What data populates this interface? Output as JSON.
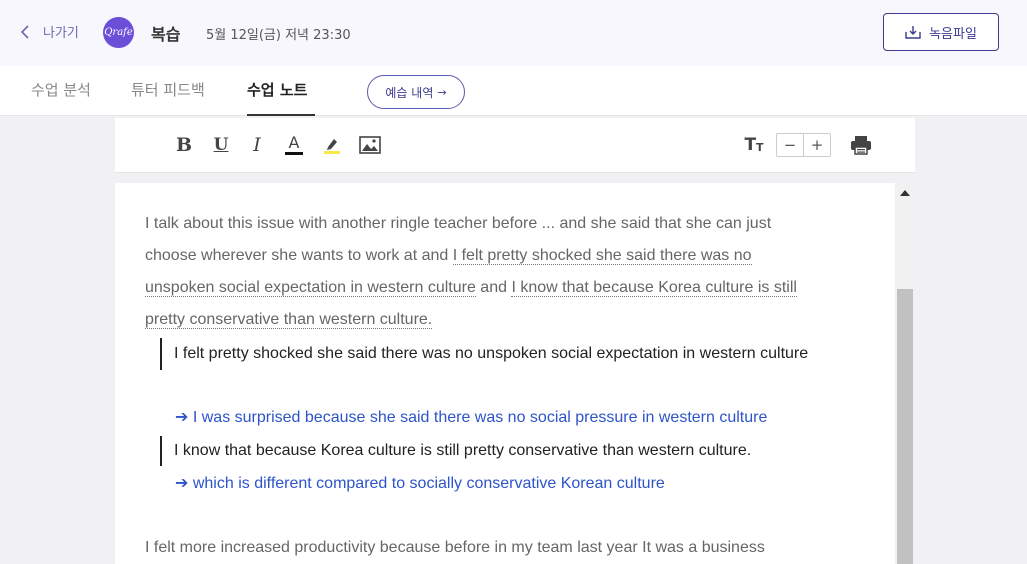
{
  "header": {
    "back_label": "나가기",
    "logo_text": "Qrafe",
    "title": "복습",
    "datetime": "5월 12일(금) 저녁 23:30",
    "recording_button": "녹음파일"
  },
  "tabs": [
    {
      "label": "수업 분석",
      "active": false
    },
    {
      "label": "튜터 피드백",
      "active": false
    },
    {
      "label": "수업 노트",
      "active": true
    }
  ],
  "preview_button": {
    "label": "예습 내역",
    "arrow": "→"
  },
  "toolbar": {
    "bold": "B",
    "underline": "U",
    "italic": "I",
    "text_color": "A",
    "font_size_big": "T",
    "font_size_small": "T",
    "decrease": "−",
    "increase": "+",
    "icons": [
      "bold-icon",
      "underline-icon",
      "italic-icon",
      "text-color-icon",
      "highlighter-icon",
      "image-icon",
      "font-size-icon",
      "print-icon"
    ],
    "highlight_color": "#f5e94a"
  },
  "note": {
    "p1_a": "I talk about this issue with another ringle teacher before ... and she said that she can just choose wherever she wants to work at and ",
    "p1_hl1": "I felt pretty shocked she said there was no unspoken social expectation in western culture",
    "p1_b": " and ",
    "p1_hl2": "I know that because Korea culture is still pretty conservative than western culture. ",
    "correction1": "I felt pretty shocked she said there was no unspoken social expectation in western culture",
    "fix1": "➔ I was surprised because she said there was no social pressure in western culture",
    "correction2": "I know that because Korea culture is still pretty conservative than western culture.",
    "fix2": "➔ which is different compared to socially conservative Korean culture",
    "p2": "I felt more increased productivity because before in my team last year It was a business"
  },
  "colors": {
    "accent": "#3b3b8f",
    "logo": "#6b4fd8",
    "fix_text": "#2d54c9"
  }
}
